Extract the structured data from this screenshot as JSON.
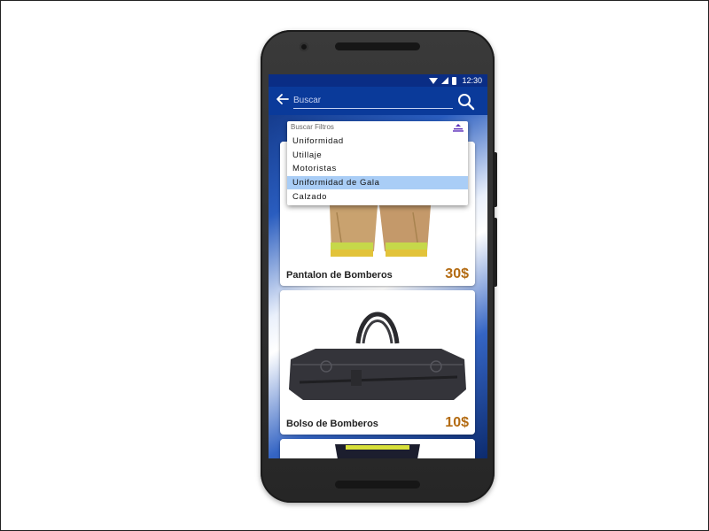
{
  "status_bar": {
    "time": "12:30",
    "icons": [
      "wifi-icon",
      "signal-icon",
      "battery-icon"
    ]
  },
  "app_bar": {
    "back_icon": "arrow-left-icon",
    "search_placeholder": "Buscar",
    "search_icon": "search-icon"
  },
  "filter": {
    "placeholder": "Buscar Filtros",
    "toggle_icon": "collapse-icon",
    "options": [
      "Uniformidad",
      "Utillaje",
      "Motoristas",
      "Uniformidad de Gala",
      "Calzado"
    ],
    "selected_index": 3
  },
  "products": [
    {
      "name": "Pantalon de Bomberos",
      "price": "30$",
      "image_icon": "trousers-image"
    },
    {
      "name": "Bolso de Bomberos",
      "price": "10$",
      "image_icon": "duffel-bag-image"
    },
    {
      "name": "",
      "price": "",
      "image_icon": "jacket-image"
    }
  ],
  "colors": {
    "app_bar": "#0a3a9a",
    "status_bar": "#0a2d85",
    "price": "#b36b12",
    "selected_option": "#a9cdf6",
    "accent_icon": "#5a2db8"
  }
}
